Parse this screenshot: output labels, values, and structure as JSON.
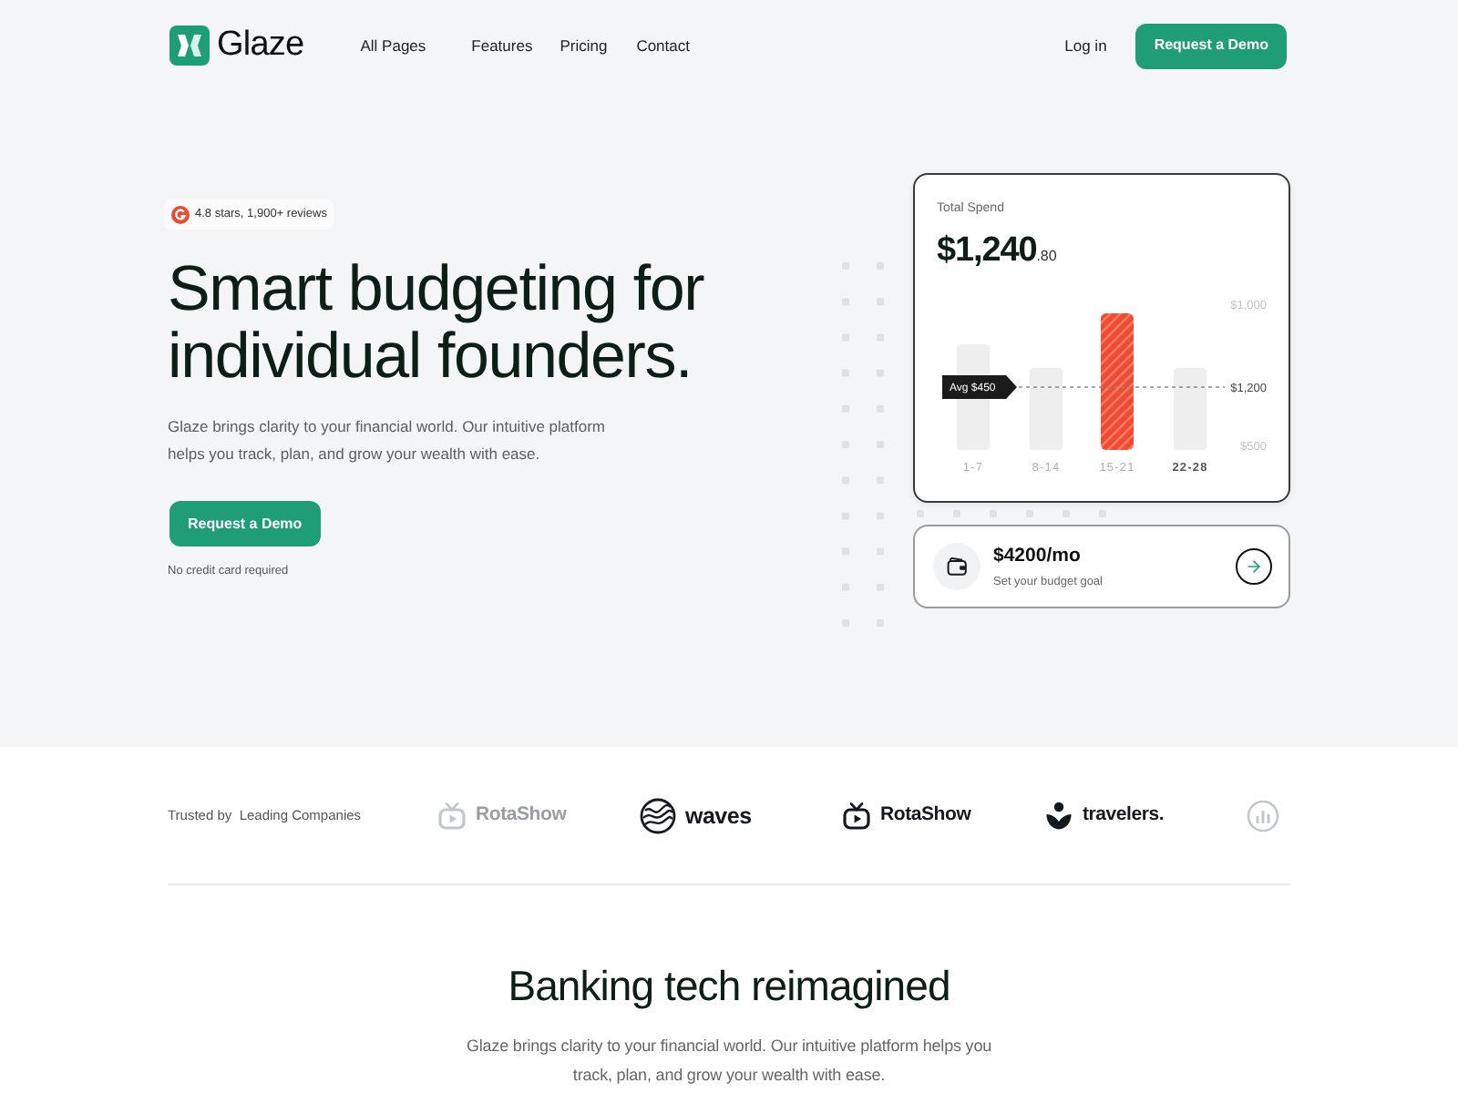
{
  "nav": {
    "logo": "Glaze",
    "links": [
      {
        "label": "All Pages"
      },
      {
        "label": "Features"
      },
      {
        "label": "Pricing"
      },
      {
        "label": "Contact"
      }
    ],
    "login": "Log in",
    "cta": "Request a Demo"
  },
  "hero": {
    "rating": "4.8 stars, 1,900+ reviews",
    "heading": "Smart budgeting for individual founders.",
    "description": "Glaze brings clarity to your financial world. Our intuitive platform helps you track, plan, and grow your wealth with ease.",
    "cta": "Request a Demo",
    "note": "No credit card required"
  },
  "spend_card": {
    "title": "Total Spend",
    "amount": "$1,240",
    "cents": ".80",
    "y_labels": [
      {
        "text": "$1,000",
        "emphasized": false
      },
      {
        "text": "$1,200",
        "emphasized": true
      },
      {
        "text": "$500",
        "emphasized": false
      }
    ],
    "average": "Avg $450",
    "bars": [
      {
        "label": "1-7",
        "highlighted": false,
        "label_emphasized": false
      },
      {
        "label": "8-14",
        "highlighted": false,
        "label_emphasized": false
      },
      {
        "label": "15-21",
        "highlighted": true,
        "label_emphasized": false
      },
      {
        "label": "22-28",
        "highlighted": false,
        "label_emphasized": true
      }
    ]
  },
  "budget_card": {
    "amount": "$4200/mo",
    "caption": "Set your budget goal"
  },
  "trusted": {
    "label": "Trusted by  Leading Companies",
    "logos": [
      {
        "kind": "tv",
        "name": "RotaShow",
        "faded": true
      },
      {
        "kind": "waves",
        "name": "waves",
        "faded": false
      },
      {
        "kind": "tv",
        "name": "RotaShow",
        "faded": false
      },
      {
        "kind": "sprout",
        "name": "travelers.",
        "faded": false
      },
      {
        "kind": "chart",
        "faded": true
      }
    ]
  },
  "section": {
    "heading": "Banking tech reimagined",
    "description": "Glaze brings clarity to your financial world. Our intuitive platform helps you track, plan, and grow your wealth with ease."
  }
}
